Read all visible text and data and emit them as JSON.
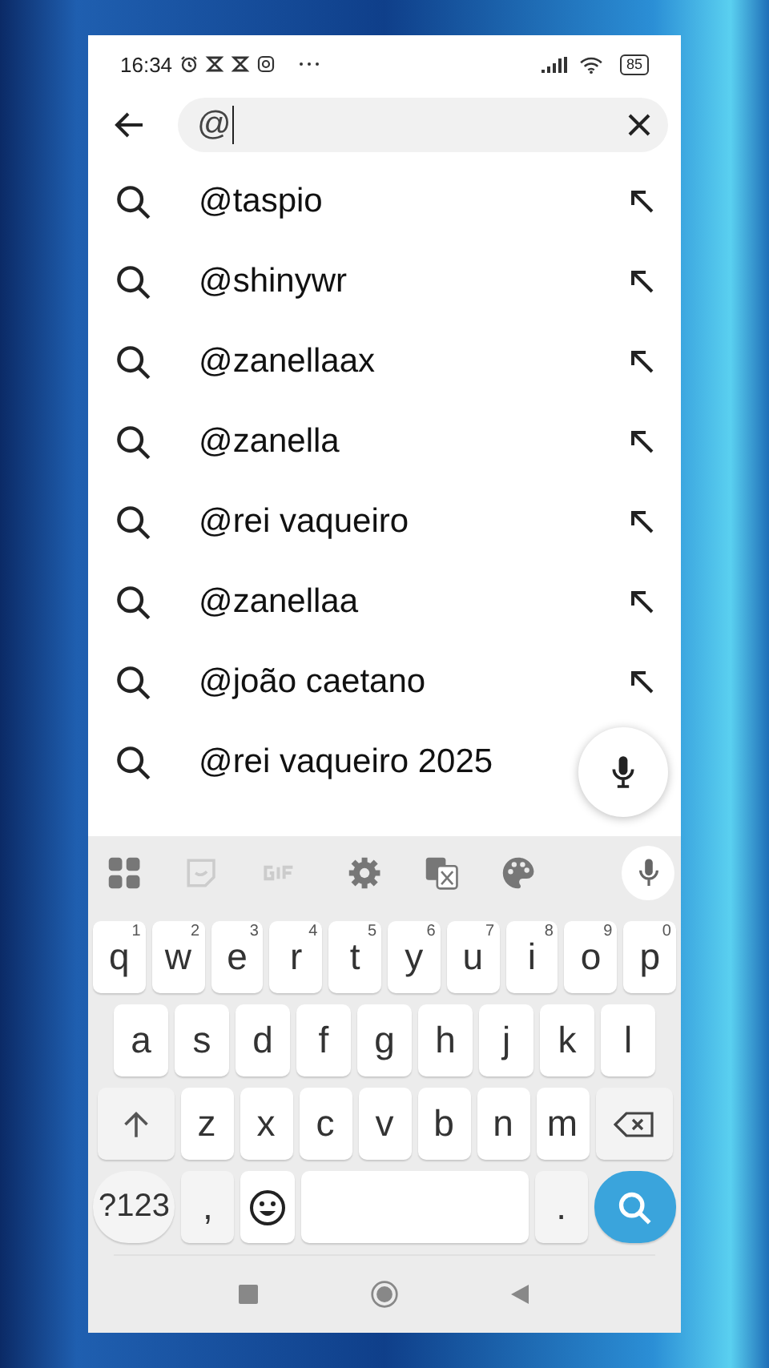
{
  "status_bar": {
    "time": "16:34",
    "battery": "85"
  },
  "search": {
    "value": "@"
  },
  "suggestions": [
    {
      "text": "@taspio"
    },
    {
      "text": "@shinywr"
    },
    {
      "text": "@zanellaax"
    },
    {
      "text": "@zanella"
    },
    {
      "text": "@rei vaqueiro"
    },
    {
      "text": "@zanellaa"
    },
    {
      "text": "@joão caetano"
    },
    {
      "text": "@rei vaqueiro 2025"
    }
  ],
  "keyboard": {
    "rows": [
      {
        "keys": [
          {
            "kind": "letter",
            "label": "q",
            "hint": "1"
          },
          {
            "kind": "letter",
            "label": "w",
            "hint": "2"
          },
          {
            "kind": "letter",
            "label": "e",
            "hint": "3"
          },
          {
            "kind": "letter",
            "label": "r",
            "hint": "4"
          },
          {
            "kind": "letter",
            "label": "t",
            "hint": "5"
          },
          {
            "kind": "letter",
            "label": "y",
            "hint": "6"
          },
          {
            "kind": "letter",
            "label": "u",
            "hint": "7"
          },
          {
            "kind": "letter",
            "label": "i",
            "hint": "8"
          },
          {
            "kind": "letter",
            "label": "o",
            "hint": "9"
          },
          {
            "kind": "letter",
            "label": "p",
            "hint": "0"
          }
        ]
      },
      {
        "keys": [
          {
            "kind": "letter",
            "label": "a"
          },
          {
            "kind": "letter",
            "label": "s"
          },
          {
            "kind": "letter",
            "label": "d"
          },
          {
            "kind": "letter",
            "label": "f"
          },
          {
            "kind": "letter",
            "label": "g"
          },
          {
            "kind": "letter",
            "label": "h"
          },
          {
            "kind": "letter",
            "label": "j"
          },
          {
            "kind": "letter",
            "label": "k"
          },
          {
            "kind": "letter",
            "label": "l"
          }
        ]
      },
      {
        "keys": [
          {
            "kind": "shift"
          },
          {
            "kind": "letter",
            "label": "z"
          },
          {
            "kind": "letter",
            "label": "x"
          },
          {
            "kind": "letter",
            "label": "c"
          },
          {
            "kind": "letter",
            "label": "v"
          },
          {
            "kind": "letter",
            "label": "b"
          },
          {
            "kind": "letter",
            "label": "n"
          },
          {
            "kind": "letter",
            "label": "m"
          },
          {
            "kind": "backspace"
          }
        ]
      },
      {
        "keys": [
          {
            "kind": "symbols",
            "label": "?123"
          },
          {
            "kind": "letter",
            "label": ","
          },
          {
            "kind": "emoji"
          },
          {
            "kind": "space"
          },
          {
            "kind": "letter",
            "label": "."
          },
          {
            "kind": "search"
          }
        ]
      }
    ]
  }
}
